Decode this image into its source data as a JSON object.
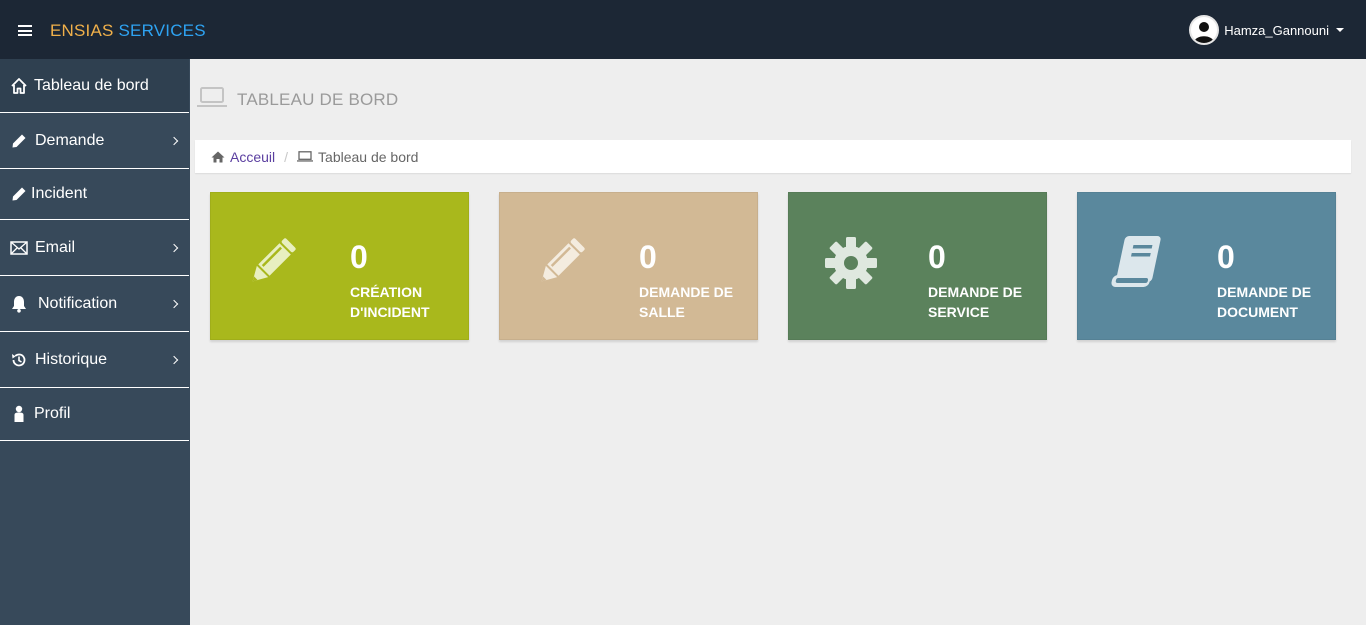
{
  "header": {
    "brand_part1": "ENSIAS",
    "brand_part2": "SERVICES",
    "username": "Hamza_Gannouni"
  },
  "sidebar": {
    "items": [
      {
        "label": "Tableau de bord",
        "icon": "home-icon",
        "has_submenu": false
      },
      {
        "label": "Demande",
        "icon": "pencil-icon",
        "has_submenu": true
      },
      {
        "label": "Incident",
        "icon": "pencil-icon",
        "has_submenu": false
      },
      {
        "label": "Email",
        "icon": "envelope-icon",
        "has_submenu": true
      },
      {
        "label": "Notification",
        "icon": "bell-icon",
        "has_submenu": true
      },
      {
        "label": "Historique",
        "icon": "history-icon",
        "has_submenu": true
      },
      {
        "label": "Profil",
        "icon": "user-icon",
        "has_submenu": false
      }
    ]
  },
  "page": {
    "title": "TABLEAU DE BORD"
  },
  "breadcrumb": {
    "home": "Acceuil",
    "current": "Tableau de bord"
  },
  "cards": [
    {
      "count": "0",
      "label": "CRÉATION D'INCIDENT",
      "icon": "pencil-icon",
      "color": "#a9b81c"
    },
    {
      "count": "0",
      "label": "DEMANDE DE SALLE",
      "icon": "pencil-icon",
      "color": "#d2b995"
    },
    {
      "count": "0",
      "label": "DEMANDE DE SERVICE",
      "icon": "gear-icon",
      "color": "#5b825c"
    },
    {
      "count": "0",
      "label": "DEMANDE DE DOCUMENT",
      "icon": "book-icon",
      "color": "#5a889d"
    }
  ],
  "colors": {
    "topbar": "#1c2735",
    "sidebar": "#37495a",
    "content_bg": "#eeeeee",
    "brand_orange": "#f0b04a",
    "brand_blue": "#2ea3f2",
    "link": "#5b3fa0"
  }
}
